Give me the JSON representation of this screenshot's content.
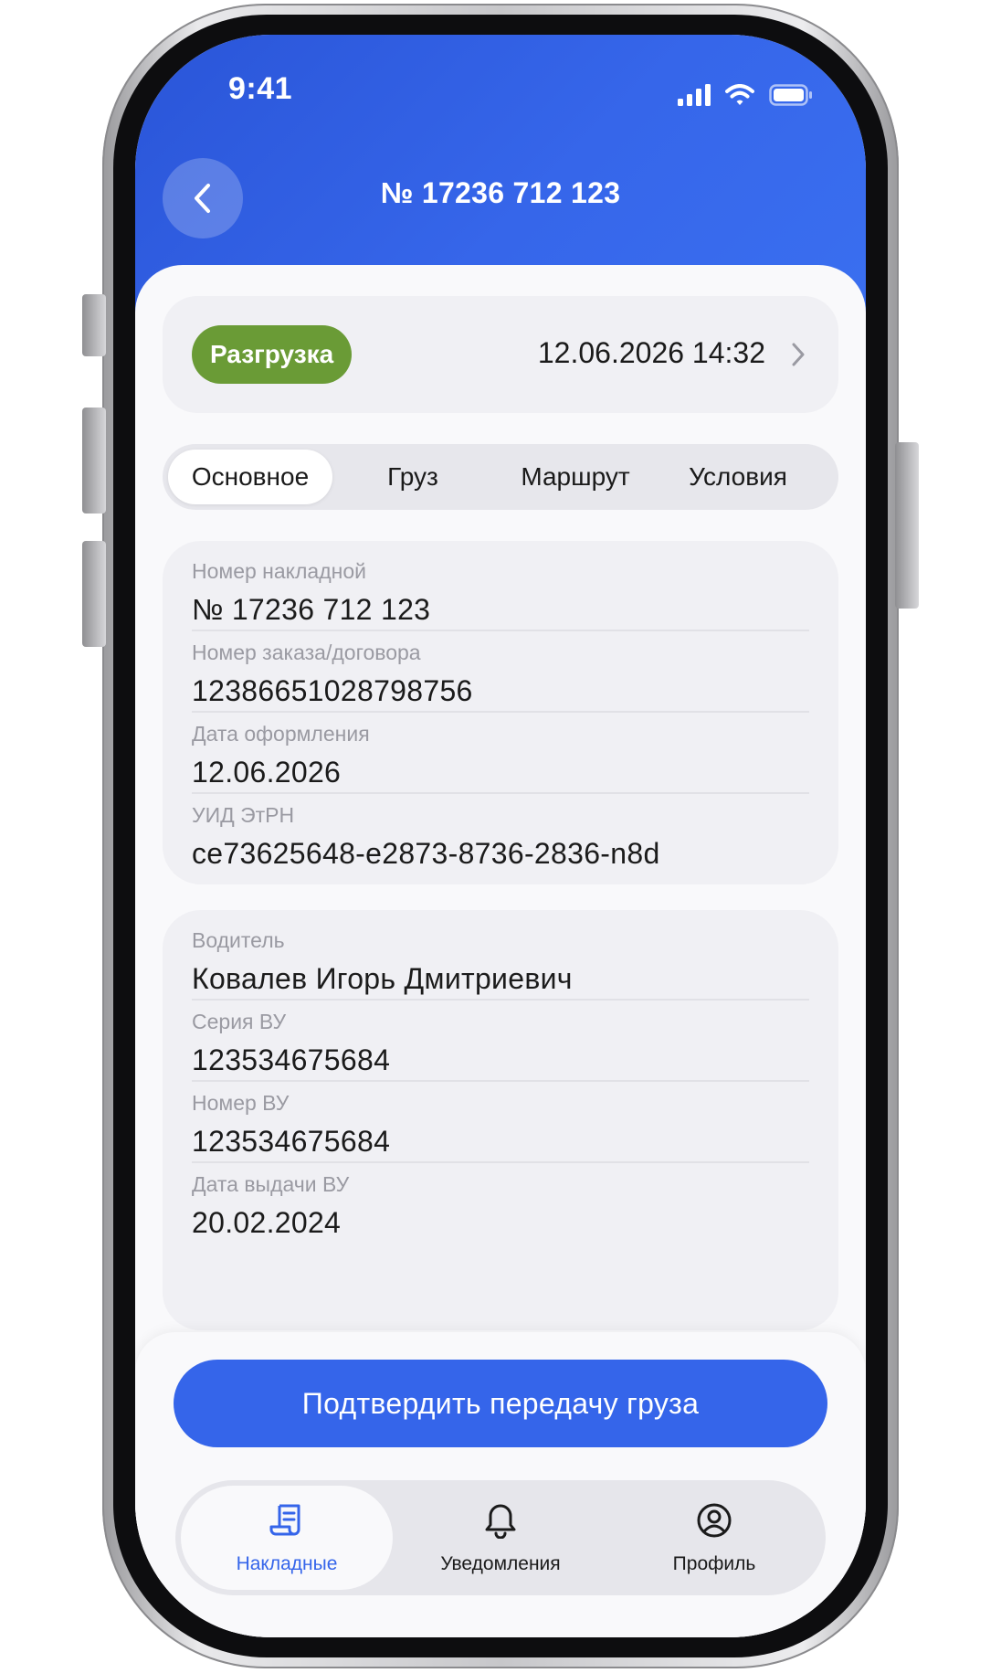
{
  "status_bar": {
    "time": "9:41"
  },
  "header": {
    "title": "№ 17236 712 123"
  },
  "status_card": {
    "badge": "Разгрузка",
    "datetime": "12.06.2026 14:32"
  },
  "tabs": [
    {
      "label": "Основное",
      "active": true
    },
    {
      "label": "Груз",
      "active": false
    },
    {
      "label": "Маршрут",
      "active": false
    },
    {
      "label": "Условия",
      "active": false
    }
  ],
  "document_card": {
    "fields": [
      {
        "label": "Номер накладной",
        "value": "№ 17236 712 123"
      },
      {
        "label": "Номер заказа/договора",
        "value": "12386651028798756"
      },
      {
        "label": "Дата оформления",
        "value": "12.06.2026"
      },
      {
        "label": "УИД ЭтРН",
        "value": "ce73625648-e2873-8736-2836-n8d"
      }
    ]
  },
  "driver_card": {
    "fields": [
      {
        "label": "Водитель",
        "value": "Ковалев Игорь Дмитриевич"
      },
      {
        "label": "Серия ВУ",
        "value": "123534675684"
      },
      {
        "label": "Номер ВУ",
        "value": "123534675684"
      },
      {
        "label": "Дата выдачи ВУ",
        "value": "20.02.2024"
      }
    ]
  },
  "confirm_button": {
    "label": "Подтвердить передачу груза"
  },
  "bottom_nav": [
    {
      "label": "Накладные",
      "icon": "waybill-icon",
      "active": true
    },
    {
      "label": "Уведомления",
      "icon": "bell-icon",
      "active": false
    },
    {
      "label": "Профиль",
      "icon": "profile-icon",
      "active": false
    }
  ],
  "colors": {
    "accent": "#3565ea",
    "header_gradient": [
      "#2a55d8",
      "#3a6ff0"
    ],
    "badge": "#6a9b36",
    "nav_active_text": "#3565ea"
  }
}
